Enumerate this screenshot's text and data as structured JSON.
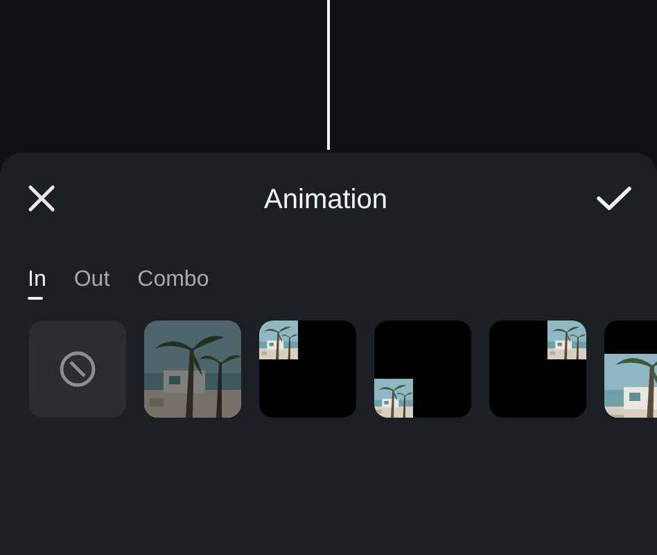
{
  "header": {
    "title": "Animation"
  },
  "tabs": [
    {
      "label": "In",
      "selected": true
    },
    {
      "label": "Out",
      "selected": false
    },
    {
      "label": "Combo",
      "selected": false
    }
  ],
  "presets": [
    {
      "kind": "none"
    },
    {
      "kind": "full"
    },
    {
      "kind": "top-left"
    },
    {
      "kind": "bottom-left"
    },
    {
      "kind": "top-right"
    },
    {
      "kind": "bottom-strip"
    }
  ]
}
